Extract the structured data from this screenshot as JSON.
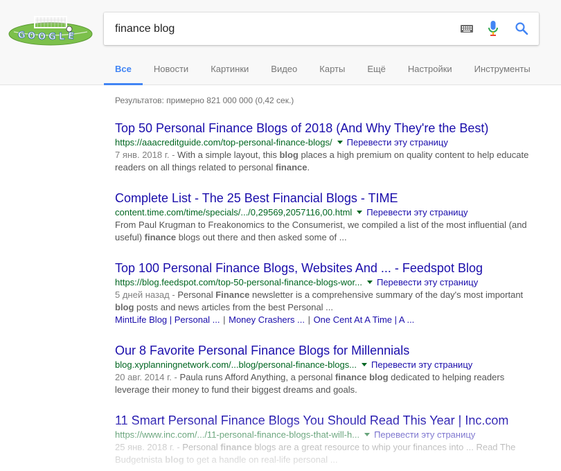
{
  "search": {
    "query": "finance blog"
  },
  "tabs": [
    {
      "label": "Все"
    },
    {
      "label": "Новости"
    },
    {
      "label": "Картинки"
    },
    {
      "label": "Видео"
    },
    {
      "label": "Карты"
    },
    {
      "label": "Ещё"
    },
    {
      "label": "Настройки"
    },
    {
      "label": "Инструменты"
    }
  ],
  "stats": "Результатов: примерно 821 000 000 (0,42 сек.)",
  "translate_label": "Перевести эту страницу",
  "results": [
    {
      "title": "Top 50 Personal Finance Blogs of 2018 (And Why They're the Best)",
      "url": "https://aaacreditguide.com/top-personal-finance-blogs/",
      "date": "7 янв. 2018 г. - ",
      "snippet_parts": [
        "With a simple layout, this ",
        "blog",
        " places a high premium on quality content to help educate readers on all things related to personal ",
        "finance",
        "."
      ]
    },
    {
      "title": "Complete List - The 25 Best Financial Blogs - TIME",
      "url": "content.time.com/time/specials/.../0,29569,2057116,00.html",
      "date": "",
      "snippet_parts": [
        "From Paul Krugman to Freakonomics to the Consumerist, we compiled a list of the most influential (and useful) ",
        "finance",
        " blogs out there and then asked some of ..."
      ]
    },
    {
      "title": "Top 100 Personal Finance Blogs, Websites And ... - Feedspot Blog",
      "url": "https://blog.feedspot.com/top-50-personal-finance-blogs-wor...",
      "date": "5 дней назад - ",
      "snippet_parts": [
        "Personal ",
        "Finance",
        " newsletter is a comprehensive summary of the day's most important ",
        "blog",
        " posts and news articles from the best Personal ..."
      ],
      "sitelinks": [
        "MintLife Blog | Personal ...",
        "Money Crashers ...",
        "One Cent At A Time | A ..."
      ]
    },
    {
      "title": "Our 8 Favorite Personal Finance Blogs for Millennials",
      "url": "blog.xyplanningnetwork.com/...blog/personal-finance-blogs...",
      "date": "20 авг. 2014 г. - ",
      "snippet_parts": [
        "Paula runs Afford Anything, a personal ",
        "finance blog",
        " dedicated to helping readers leverage their money to fund their biggest dreams and goals."
      ]
    },
    {
      "title": "11 Smart Personal Finance Blogs You Should Read This Year | Inc.com",
      "url": "https://www.inc.com/.../11-personal-finance-blogs-that-will-h...",
      "date": "25 янв. 2018 г. - ",
      "snippet_parts": [
        "Personal ",
        "finance",
        " blogs are a great resource to whip your finances into ... Read The Budgetnista ",
        "blog",
        " to get a handle on real-life personal ..."
      ]
    }
  ]
}
